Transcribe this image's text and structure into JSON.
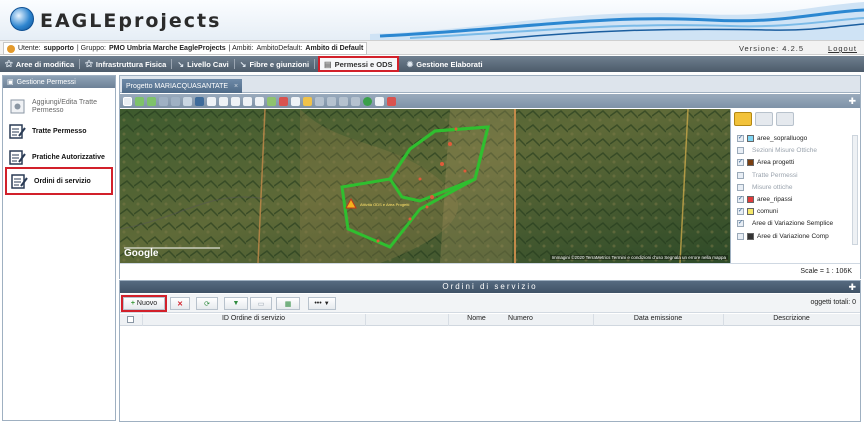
{
  "header": {
    "logo_text": "EAGLEprojects"
  },
  "userbar": {
    "utente_label": "Utente:",
    "utente": "supporto",
    "gruppo_label": "| Gruppo:",
    "gruppo": "PMO Umbria Marche EagleProjects",
    "ambiti_label": "| Ambiti:",
    "ambiti": "AmbitoDefault:",
    "ambito": "Ambito di Default",
    "version": "Versione: 4.2.5",
    "logout": "Logout"
  },
  "nav": [
    {
      "label": "Aree di modifica",
      "icon": "tower-icon"
    },
    {
      "label": "Infrastruttura Fisica",
      "icon": "tower-icon"
    },
    {
      "label": "Livello Cavi",
      "icon": "cable-icon"
    },
    {
      "label": "Fibre e giunzioni",
      "icon": "fiber-icon"
    },
    {
      "label": "Permessi e ODS",
      "icon": "document-icon"
    },
    {
      "label": "Gestione Elaborati",
      "icon": "gear-icon"
    }
  ],
  "sidebar": {
    "title": "Gestione Permessi",
    "items": [
      {
        "label": "Aggiungi/Edita Tratte Permesso",
        "icon": "add-path-icon"
      },
      {
        "label": "Tratte Permesso",
        "icon": "edit-path-icon"
      },
      {
        "label": "Pratiche Autorizzative",
        "icon": "edit-document-icon"
      },
      {
        "label": "Ordini di servizio",
        "icon": "edit-order-icon"
      }
    ]
  },
  "map": {
    "tab_label": "Progetto MARIACQUASANTATE",
    "tab_close": "×",
    "marker_label": "Attività ODS e Area Progetti",
    "google_label": "Google",
    "attribution": "Immagini ©2020 TerraMetrics   Termini e condizioni d'uso   Segnala un errore nella mappa",
    "scale": "Scale = 1 : 106K"
  },
  "layers": [
    {
      "label": "aree_sopralluogo",
      "checked": true,
      "color": "#7fd6f5"
    },
    {
      "label": "Sezioni Misure Ottiche",
      "checked": false,
      "color": "",
      "muted": true
    },
    {
      "label": "Area progetti",
      "checked": true,
      "color": "#7a3e10"
    },
    {
      "label": "Tratte Permessi",
      "checked": false,
      "color": "",
      "muted": true
    },
    {
      "label": "Misure ottiche",
      "checked": false,
      "color": "",
      "muted": true
    },
    {
      "label": "aree_ripassi",
      "checked": true,
      "color": "#e03a3a"
    },
    {
      "label": "comuni",
      "checked": true,
      "color": "#f5e86a"
    },
    {
      "label": "Aree di Variazione Semplice",
      "checked": true,
      "color": ""
    },
    {
      "label": "Aree di Variazione Comp",
      "checked": false,
      "color": "#333333"
    }
  ],
  "grid": {
    "title": "Ordini di servizio",
    "new_button": "Nuovo",
    "more_button": "•••",
    "total": "oggetti totali: 0",
    "columns": [
      "ID Ordine di servizio",
      "Nome",
      "Numero",
      "Data emissione",
      "Descrizione"
    ]
  }
}
